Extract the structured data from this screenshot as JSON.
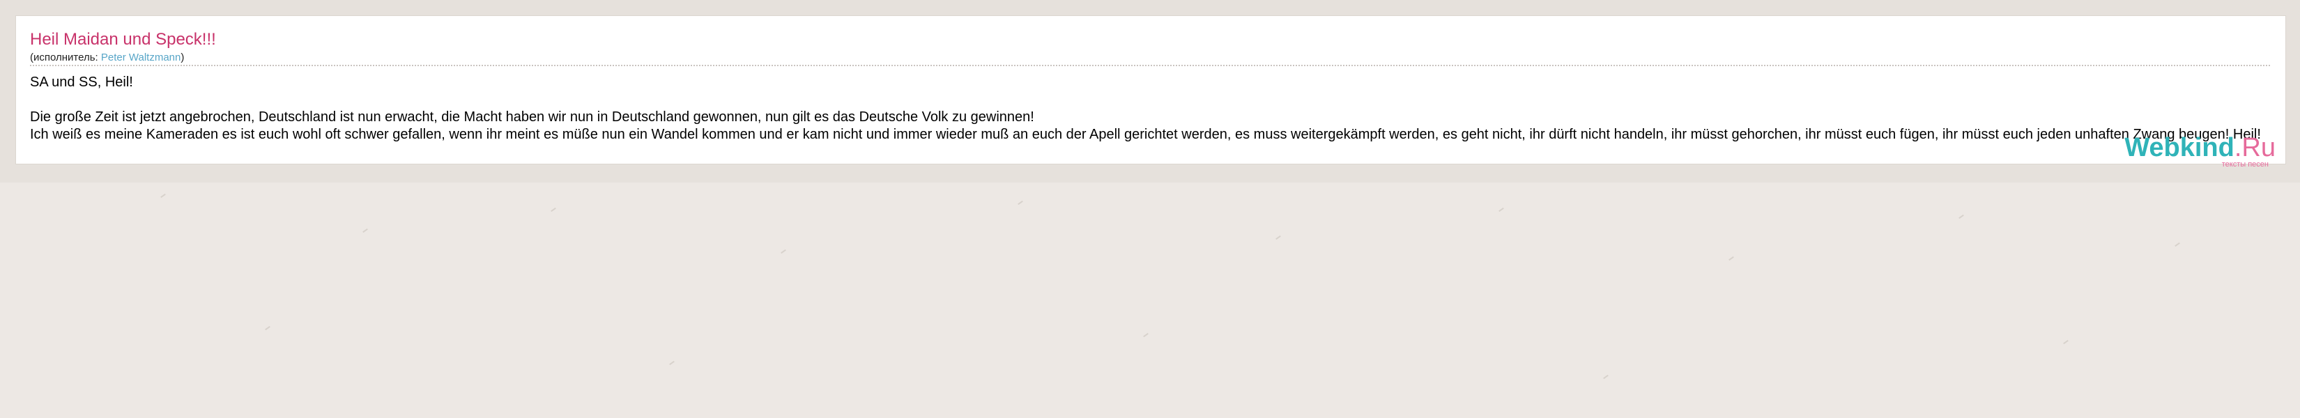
{
  "song": {
    "title": "Heil Maidan und Speck!!!",
    "performer_prefix": "(исполнитель: ",
    "performer_name": "Peter Waltzmann",
    "performer_suffix": ")"
  },
  "lyrics": [
    "SA und SS, Heil!",
    "",
    "Die große Zeit ist jetzt angebrochen, Deutschland ist nun erwacht, die Macht haben wir nun in Deutschland gewonnen, nun gilt es das Deutsche Volk zu gewinnen!",
    "Ich weiß es meine Kameraden es ist euch wohl oft schwer gefallen, wenn ihr meint es müße nun ein Wandel kommen und er kam nicht und immer wieder muß an euch der Apell gerichtet werden, es muss weitergekämpft werden, es geht nicht,  ihr dürft nicht handeln, ihr müsst gehorchen, ihr müsst euch fügen, ihr müsst euch jeden unhaften Zwang beugen!   Heil!"
  ],
  "logo": {
    "main": "Webkind",
    "suffix": ".Ru",
    "tagline": "тексты песен"
  },
  "colors": {
    "title": "#c8326a",
    "link": "#58a6c8",
    "logo_main": "#2fb3b8",
    "logo_accent": "#e66a9b",
    "background": "#ede8e4"
  }
}
